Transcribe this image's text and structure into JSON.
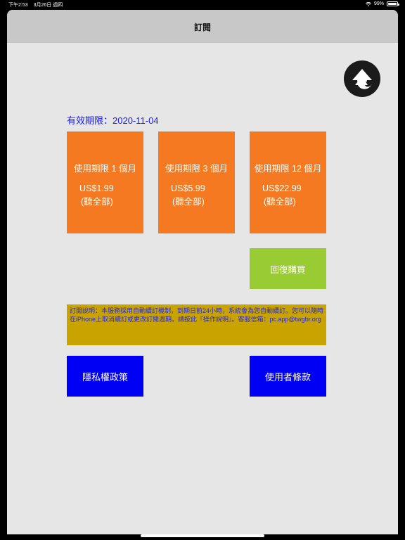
{
  "status_bar": {
    "time": "下午2:53",
    "date": "3月26日 週四",
    "battery": "99%",
    "battery_level": 0.99
  },
  "nav": {
    "title": "訂閱"
  },
  "expiry": {
    "label": "有效期限：2020-11-04"
  },
  "plans": [
    {
      "name": "使用期限 1 個月",
      "price": "US$1.99",
      "sub": "(聽全部)"
    },
    {
      "name": "使用期限 3 個月",
      "price": "US$5.99",
      "sub": "(聽全部)"
    },
    {
      "name": "使用期限 12 個月",
      "price": "US$22.99",
      "sub": "(聽全部)"
    }
  ],
  "restore": {
    "label": "回復購買"
  },
  "notice": {
    "text": "訂閱說明：本服務採用自動續訂機制，到期日前24小時，系統會為您自動續訂。您可以隨時在iPhone上取消續訂或更改訂閱週期。請按此『操作說明』。客服信箱：pc.app@twgbr.org"
  },
  "buttons": {
    "privacy": "隱私權政策",
    "terms": "使用者條款"
  },
  "icons": {
    "back": "curved-arrow-up-icon",
    "wifi": "wifi-icon",
    "battery": "battery-icon"
  },
  "colors": {
    "plan_orange": "#f47920",
    "restore_green": "#99cc33",
    "notice_gold": "#c9a300",
    "link_blue": "#0000f5",
    "text_blue": "#1a1ae6",
    "sheet_bg": "#e6e6e6",
    "nav_bg": "#c8c8c8"
  }
}
